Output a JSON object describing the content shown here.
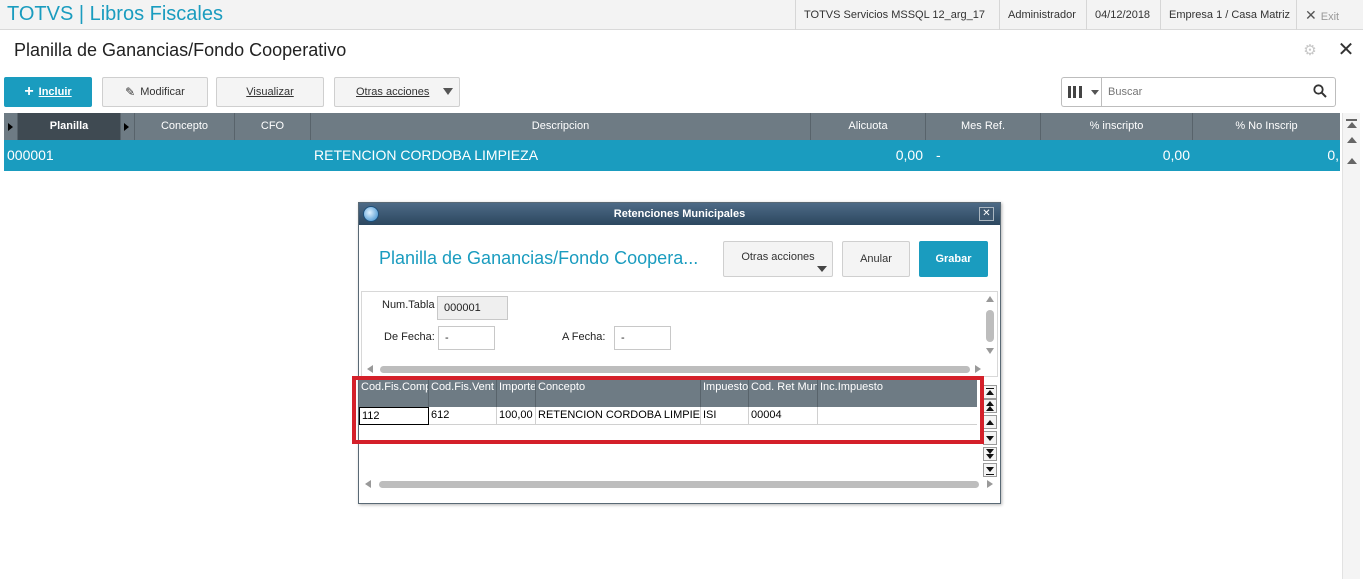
{
  "topbar": {
    "app_title": "TOTVS | Libros Fiscales",
    "environment": "TOTVS Servicios MSSQL 12_arg_17",
    "user": "Administrador",
    "date": "04/12/2018",
    "company": "Empresa 1 / Casa Matriz",
    "exit_label": "Exit"
  },
  "page": {
    "title": "Planilla de Ganancias/Fondo Cooperativo"
  },
  "toolbar": {
    "include_label": "Incluir",
    "modify_label": "Modificar",
    "view_label": "Visualizar",
    "other_actions_label": "Otras acciones",
    "search_placeholder": "Buscar"
  },
  "grid": {
    "columns": [
      "Planilla",
      "Concepto",
      "CFO",
      "Descripcion",
      "Alicuota",
      "Mes Ref.",
      "% inscripto",
      "% No Inscrip"
    ],
    "rows": [
      {
        "planilla": "000001",
        "concepto": "",
        "cfo": "",
        "descripcion": "RETENCION CORDOBA LIMPIEZA",
        "alicuota": "0,00",
        "mes_ref": "-",
        "pct_inscripto": "0,00",
        "pct_no_inscrip": "0,"
      }
    ]
  },
  "dialog": {
    "window_title": "Retenciones Municipales",
    "heading": "Planilla de Ganancias/Fondo Coopera...",
    "other_actions_label": "Otras acciones",
    "cancel_label": "Anular",
    "save_label": "Grabar",
    "form": {
      "num_tabla_label": "Num.Tabla",
      "num_tabla_value": "000001",
      "de_fecha_label": "De Fecha:",
      "de_fecha_value": "-",
      "a_fecha_label": "A  Fecha:",
      "a_fecha_value": "-"
    },
    "browse": {
      "columns": [
        "Cod.Fis.Comp",
        "Cod.Fis.Vent",
        "Importe",
        "Concepto",
        "Impuesto",
        "Cod. Ret Mun",
        "Inc.Impuesto"
      ],
      "rows": [
        {
          "cod_fis_comp": "112",
          "cod_fis_vent": "612",
          "importe": "100,00",
          "concepto": "RETENCION CORDOBA LIMPIEZA",
          "impuesto": "ISI",
          "cod_ret_mun": "00004",
          "inc_impuesto": ""
        }
      ]
    }
  },
  "colors": {
    "accent": "#1a9cbf",
    "grid_header": "#6e7b84",
    "highlight": "#d4202a"
  }
}
